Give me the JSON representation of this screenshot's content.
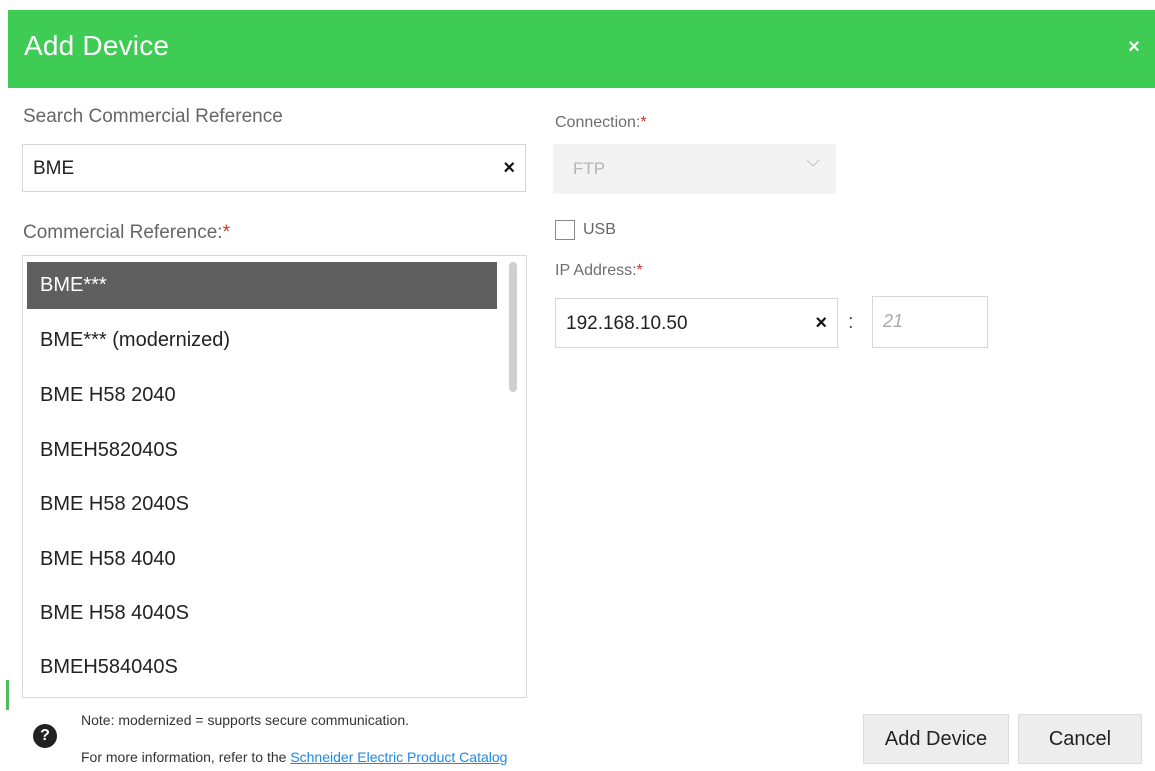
{
  "dialog": {
    "title": "Add Device",
    "close_label": "×"
  },
  "search": {
    "label": "Search Commercial Reference",
    "value": "BME",
    "clear_label": "×"
  },
  "commercial_reference": {
    "label": "Commercial Reference:",
    "required_mark": "*",
    "items": [
      "BME***",
      "BME*** (modernized)",
      "BME H58 2040",
      "BMEH582040S",
      "BME H58 2040S",
      "BME H58 4040",
      "BME H58 4040S",
      "BMEH584040S"
    ],
    "selected_index": 0
  },
  "connection": {
    "label": "Connection:",
    "required_mark": "*",
    "value": "FTP",
    "disabled": true
  },
  "usb": {
    "label": "USB",
    "checked": false
  },
  "ip": {
    "label": "IP Address:",
    "required_mark": "*",
    "value": "192.168.10.50",
    "clear_label": "×",
    "separator": ":",
    "port_placeholder": "21"
  },
  "footer": {
    "note_line1": "Note: modernized = supports secure communication.",
    "note_line2_prefix": "For more information, refer to the ",
    "catalog_link": "Schneider Electric Product Catalog",
    "help_icon": "question-circle",
    "add_button": "Add Device",
    "cancel_button": "Cancel"
  },
  "colors": {
    "titlebar": "#3fcc55",
    "selected_item": "#5f5f5f",
    "required": "#c0392b",
    "link": "#1e88e5"
  }
}
